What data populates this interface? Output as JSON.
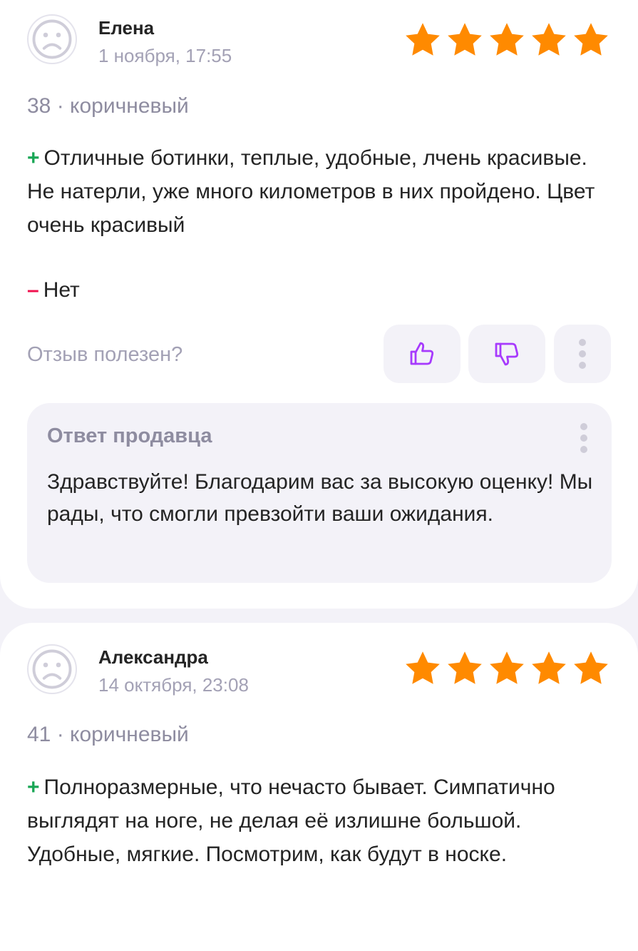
{
  "reviews": [
    {
      "author": "Елена",
      "date": "1 ноября, 17:55",
      "rating": 5,
      "size_color": "38 · коричневый",
      "pros_mark": "+",
      "pros": "Отличные ботинки, теплые, удобные, лчень красивые. Не натерли, уже много километров в них пройдено. Цвет очень красивый",
      "cons_mark": "–",
      "cons": "Нет",
      "helpful_label": "Отзыв полезен?",
      "seller_reply": {
        "title": "Ответ продавца",
        "text": "Здравствуйте! Благодарим вас за высокую оценку! Мы рады, что смогли превзойти ваши ожидания."
      }
    },
    {
      "author": "Александра",
      "date": "14 октября, 23:08",
      "rating": 5,
      "size_color": "41 · коричневый",
      "pros_mark": "+",
      "pros": "Полноразмерные, что нечасто бывает. Симпатично выглядят на ноге, не делая её излишне большой. Удобные, мягкие. Посмотрим, как будут в носке."
    }
  ],
  "colors": {
    "star": "#ff8a00",
    "accent": "#a73afd",
    "plus": "#19a655",
    "minus": "#f0104e",
    "muted_text": "#a3a1b5",
    "page_bg": "#f3f2f8"
  },
  "icons": {
    "avatar": "sad-face-icon",
    "rating": "star-icon",
    "like": "thumbs-up-icon",
    "dislike": "thumbs-down-icon",
    "more": "more-vertical-icon"
  }
}
